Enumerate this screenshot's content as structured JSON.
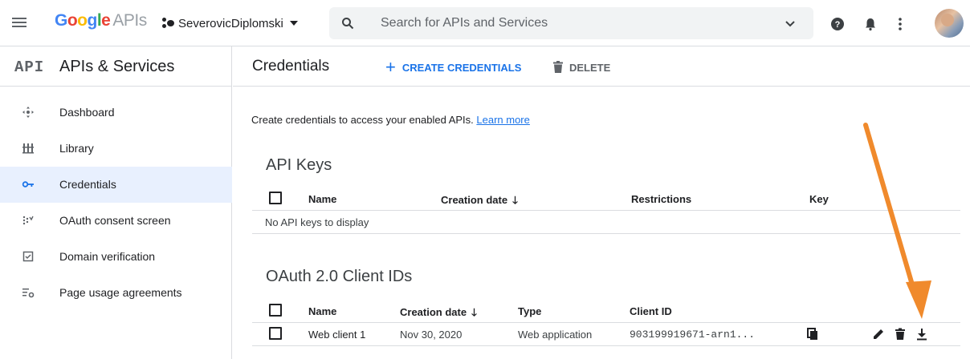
{
  "topbar": {
    "logo_google": [
      "G",
      "o",
      "o",
      "g",
      "l",
      "e"
    ],
    "logo_google_colors": [
      "#4285F4",
      "#EA4335",
      "#FBBC05",
      "#4285F4",
      "#34A853",
      "#EA4335"
    ],
    "logo_apis": "APIs",
    "project_name": "SeverovicDiplomski",
    "search_placeholder": "Search for APIs and Services",
    "icons": [
      "menu-icon",
      "search-icon",
      "chevron-down-icon",
      "help-icon",
      "notifications-icon",
      "more-vert-icon",
      "avatar"
    ]
  },
  "sidebar": {
    "logo": "API",
    "title": "APIs & Services",
    "items": [
      {
        "label": "Dashboard",
        "icon": "dashboard-icon",
        "active": false
      },
      {
        "label": "Library",
        "icon": "library-icon",
        "active": false
      },
      {
        "label": "Credentials",
        "icon": "key-icon",
        "active": true
      },
      {
        "label": "OAuth consent screen",
        "icon": "consent-icon",
        "active": false
      },
      {
        "label": "Domain verification",
        "icon": "checkbox-icon",
        "active": false
      },
      {
        "label": "Page usage agreements",
        "icon": "settings-list-icon",
        "active": false
      }
    ]
  },
  "main": {
    "title": "Credentials",
    "create_label": "CREATE CREDENTIALS",
    "delete_label": "DELETE",
    "intro_text": "Create credentials to access your enabled APIs.",
    "learn_more": "Learn more",
    "api_keys": {
      "title": "API Keys",
      "columns": [
        "Name",
        "Creation date",
        "Restrictions",
        "Key"
      ],
      "empty": "No API keys to display"
    },
    "oauth": {
      "title": "OAuth 2.0 Client IDs",
      "columns": [
        "Name",
        "Creation date",
        "Type",
        "Client ID"
      ],
      "rows": [
        {
          "name": "Web client 1",
          "date": "Nov 30, 2020",
          "type": "Web application",
          "client_id": "903199919671-arn1..."
        }
      ]
    }
  },
  "colors": {
    "accent": "#1a73e8",
    "active_bg": "#e8f0fe",
    "annotation_arrow": "#f08a2c"
  }
}
